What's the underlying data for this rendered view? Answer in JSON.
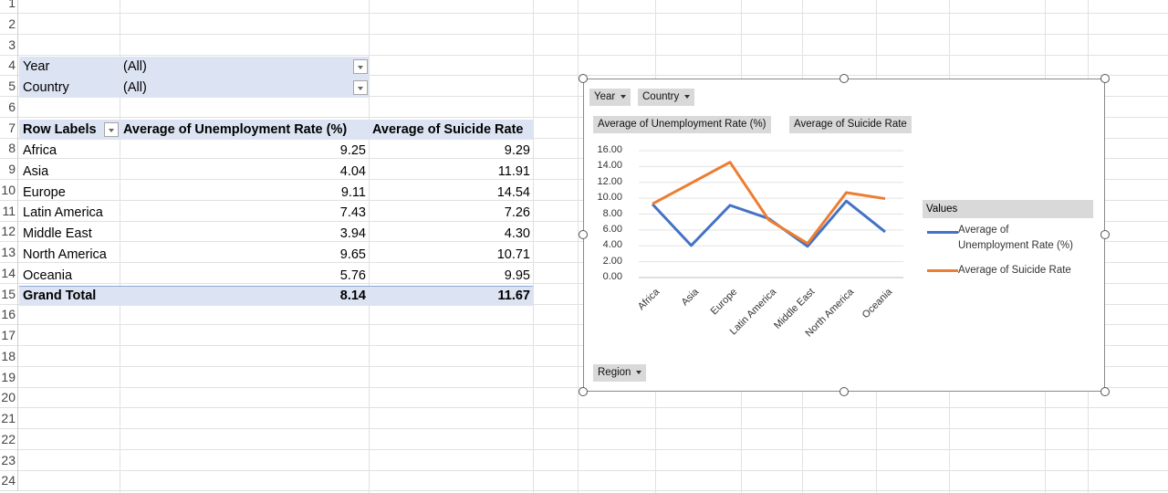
{
  "row_numbers": [
    "1",
    "2",
    "3",
    "4",
    "5",
    "6",
    "7",
    "8",
    "9",
    "10",
    "11",
    "12",
    "13",
    "14",
    "15",
    "16",
    "17",
    "18",
    "19",
    "20",
    "21",
    "22",
    "23",
    "24"
  ],
  "filters": {
    "year": {
      "label": "Year",
      "value": "(All)"
    },
    "country": {
      "label": "Country",
      "value": "(All)"
    }
  },
  "pivot": {
    "headers": [
      "Row Labels",
      "Average of Unemployment Rate (%)",
      "Average of Suicide Rate"
    ],
    "rows": [
      [
        "Africa",
        "9.25",
        "9.29"
      ],
      [
        "Asia",
        "4.04",
        "11.91"
      ],
      [
        "Europe",
        "9.11",
        "14.54"
      ],
      [
        "Latin America",
        "7.43",
        "7.26"
      ],
      [
        "Middle East",
        "3.94",
        "4.30"
      ],
      [
        "North America",
        "9.65",
        "10.71"
      ],
      [
        "Oceania",
        "5.76",
        "9.95"
      ]
    ],
    "total": [
      "Grand Total",
      "8.14",
      "11.67"
    ]
  },
  "chart_buttons": {
    "year": "Year",
    "country": "Country",
    "series1": "Average of Unemployment Rate (%)",
    "series2": "Average of Suicide Rate",
    "region": "Region"
  },
  "legend": {
    "title": "Values",
    "item1_line1": "Average of",
    "item1_line2": "Unemployment Rate (%)",
    "item2": "Average of Suicide Rate"
  },
  "chart_data": {
    "type": "line",
    "categories": [
      "Africa",
      "Asia",
      "Europe",
      "Latin America",
      "Middle East",
      "North America",
      "Oceania"
    ],
    "series": [
      {
        "name": "Average of Unemployment Rate (%)",
        "values": [
          9.25,
          4.04,
          9.11,
          7.43,
          3.94,
          9.65,
          5.76
        ],
        "color": "#4472c4"
      },
      {
        "name": "Average of Suicide Rate",
        "values": [
          9.29,
          11.91,
          14.54,
          7.26,
          4.3,
          10.71,
          9.95
        ],
        "color": "#ed7d31"
      }
    ],
    "yticks": [
      "16.00",
      "14.00",
      "12.00",
      "10.00",
      "8.00",
      "6.00",
      "4.00",
      "2.00",
      "0.00"
    ],
    "ylim": [
      0,
      16
    ],
    "grid": true,
    "legend_position": "right"
  }
}
